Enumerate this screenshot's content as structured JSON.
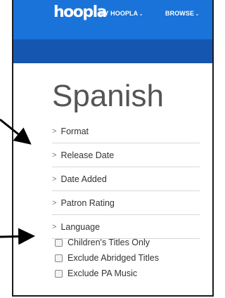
{
  "header": {
    "logo": "hoopla",
    "nav": [
      "MY HOOPLA",
      "BROWSE"
    ]
  },
  "page_title": "Spanish",
  "filters": [
    "Format",
    "Release Date",
    "Date Added",
    "Patron Rating",
    "Language"
  ],
  "checkboxes": [
    "Children's Titles Only",
    "Exclude Abridged Titles",
    "Exclude PA Music"
  ],
  "colors": {
    "topbar": "#1a73d9",
    "subbar": "#1557b0",
    "title": "#555555"
  },
  "icons": {
    "filter_chevron": "chevron-right-icon",
    "nav_caret": "chevron-down-icon",
    "annotation": "arrow-icon"
  }
}
